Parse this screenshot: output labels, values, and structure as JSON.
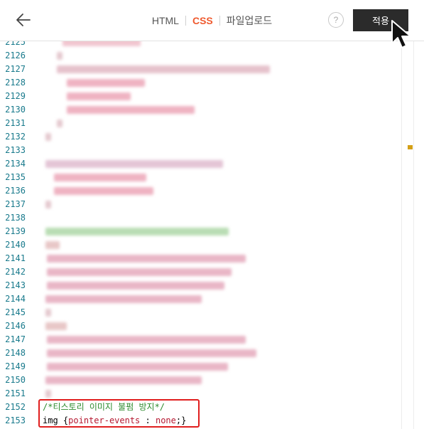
{
  "header": {
    "tabs": [
      {
        "label": "HTML",
        "active": false
      },
      {
        "label": "CSS",
        "active": true
      },
      {
        "label": "파일업로드",
        "active": false
      }
    ],
    "help_label": "?",
    "apply_label": "적용"
  },
  "editor": {
    "line_numbers": [
      "2125",
      "2126",
      "2127",
      "2128",
      "2129",
      "2130",
      "2131",
      "2132",
      "2133",
      "2134",
      "2135",
      "2136",
      "2137",
      "2138",
      "2139",
      "2140",
      "2141",
      "2142",
      "2143",
      "2144",
      "2145",
      "2146",
      "2147",
      "2148",
      "2149",
      "2150",
      "2151",
      "2152",
      "2153"
    ],
    "visible_code": [
      {
        "line": "2152",
        "text": "/*티스토리 이미지 불펌 방지*/",
        "color": "#2e8b2e"
      },
      {
        "line": "2153",
        "parts": [
          {
            "text": "img",
            "color": "#000000"
          },
          {
            "text": " {",
            "color": "#000000"
          },
          {
            "text": "pointer-events",
            "color": "#b5172f"
          },
          {
            "text": " : ",
            "color": "#000000"
          },
          {
            "text": "none",
            "color": "#b5172f"
          },
          {
            "text": ";}",
            "color": "#000000"
          }
        ]
      }
    ]
  },
  "colors": {
    "active_tab": "#ef5a2f",
    "apply_button_bg": "#2b2b2b",
    "highlight_border": "#e01e1e",
    "line_number": "#197a8c",
    "scroll_marker": "#d4a017"
  },
  "icons": {
    "back": "back-arrow-icon",
    "cursor": "mouse-cursor-icon"
  }
}
